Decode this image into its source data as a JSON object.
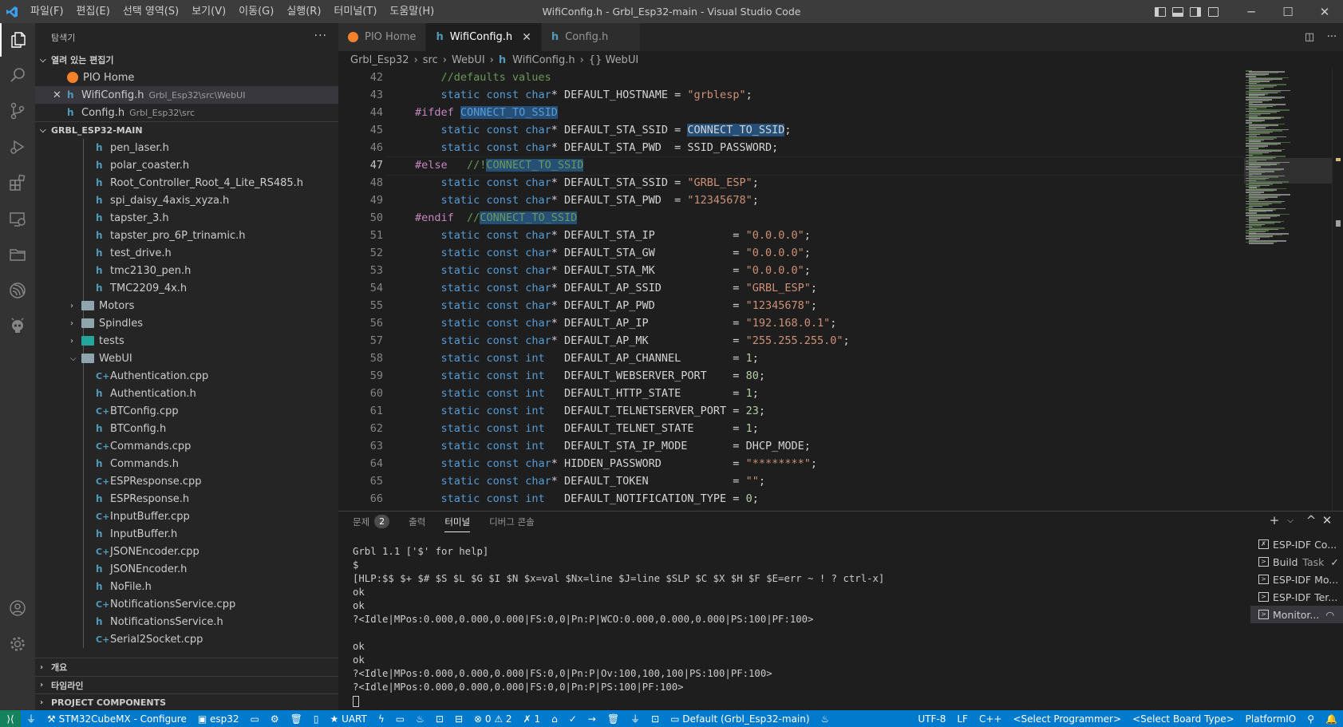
{
  "titlebar": {
    "menus": [
      "파일(F)",
      "편집(E)",
      "선택 영역(S)",
      "보기(V)",
      "이동(G)",
      "실행(R)",
      "터미널(T)",
      "도움말(H)"
    ],
    "title": "WifiConfig.h - Grbl_Esp32-main - Visual Studio Code"
  },
  "sidebar": {
    "header": "탐색기",
    "open_editors_title": "열려 있는 편집기",
    "open_editors": [
      {
        "name": "PIO Home",
        "desc": ""
      },
      {
        "name": "WifiConfig.h",
        "desc": "Grbl_Esp32\\src\\WebUI"
      },
      {
        "name": "Config.h",
        "desc": "Grbl_Esp32\\src"
      }
    ],
    "project_title": "GRBL_ESP32-MAIN",
    "files_top": [
      "pen_laser.h",
      "polar_coaster.h",
      "Root_Controller_Root_4_Lite_RS485.h",
      "spi_daisy_4axis_xyza.h",
      "tapster_3.h",
      "tapster_pro_6P_trinamic.h",
      "test_drive.h",
      "tmc2130_pen.h",
      "TMC2209_4x.h"
    ],
    "folders": [
      "Motors",
      "Spindles",
      "tests",
      "WebUI"
    ],
    "webui_files": [
      {
        "name": "Authentication.cpp",
        "type": "cpp"
      },
      {
        "name": "Authentication.h",
        "type": "h"
      },
      {
        "name": "BTConfig.cpp",
        "type": "cpp"
      },
      {
        "name": "BTConfig.h",
        "type": "h"
      },
      {
        "name": "Commands.cpp",
        "type": "cpp"
      },
      {
        "name": "Commands.h",
        "type": "h"
      },
      {
        "name": "ESPResponse.cpp",
        "type": "cpp"
      },
      {
        "name": "ESPResponse.h",
        "type": "h"
      },
      {
        "name": "InputBuffer.cpp",
        "type": "cpp"
      },
      {
        "name": "InputBuffer.h",
        "type": "h"
      },
      {
        "name": "JSONEncoder.cpp",
        "type": "cpp"
      },
      {
        "name": "JSONEncoder.h",
        "type": "h"
      },
      {
        "name": "NoFile.h",
        "type": "h"
      },
      {
        "name": "NotificationsService.cpp",
        "type": "cpp"
      },
      {
        "name": "NotificationsService.h",
        "type": "h"
      },
      {
        "name": "Serial2Socket.cpp",
        "type": "cpp"
      }
    ],
    "bottom_sections": [
      "개요",
      "타임라인",
      "PROJECT COMPONENTS"
    ]
  },
  "tabs": [
    {
      "label": "PIO Home",
      "icon": "pio"
    },
    {
      "label": "WifiConfig.h",
      "icon": "h",
      "active": true
    },
    {
      "label": "Config.h",
      "icon": "h"
    }
  ],
  "breadcrumb": [
    "Grbl_Esp32",
    "src",
    "WebUI",
    "WifiConfig.h",
    "{} WebUI"
  ],
  "editor": {
    "active_line": 47,
    "lines": [
      {
        "n": 42,
        "html": "    <span class='cmt'>//defaults values</span>"
      },
      {
        "n": 43,
        "html": "    <span class='kw'>static</span> <span class='kw'>const</span> <span class='kw'>char</span>* DEFAULT_HOSTNAME = <span class='str'>\"grblesp\"</span>;"
      },
      {
        "n": 44,
        "html": "<span class='pp'>#ifdef</span> <span class='hl mac'>CONNECT_TO_SSID</span>"
      },
      {
        "n": 45,
        "html": "    <span class='kw'>static</span> <span class='kw'>const</span> <span class='kw'>char</span>* DEFAULT_STA_SSID = <span class='hl'>CONNECT_TO_SSID</span>;"
      },
      {
        "n": 46,
        "html": "    <span class='kw'>static</span> <span class='kw'>const</span> <span class='kw'>char</span>* DEFAULT_STA_PWD  = SSID_PASSWORD;"
      },
      {
        "n": 47,
        "html": "<span class='pp'>#else</span>   <span class='cmt'>//!<span class='hl'>CONNECT_TO_SSID</span></span>"
      },
      {
        "n": 48,
        "html": "    <span class='kw'>static</span> <span class='kw'>const</span> <span class='kw'>char</span>* DEFAULT_STA_SSID = <span class='str'>\"GRBL_ESP\"</span>;"
      },
      {
        "n": 49,
        "html": "    <span class='kw'>static</span> <span class='kw'>const</span> <span class='kw'>char</span>* DEFAULT_STA_PWD  = <span class='str'>\"12345678\"</span>;"
      },
      {
        "n": 50,
        "html": "<span class='pp'>#endif</span>  <span class='cmt'>//<span class='hl'>CONNECT_TO_SSID</span></span>"
      },
      {
        "n": 51,
        "html": "    <span class='kw'>static</span> <span class='kw'>const</span> <span class='kw'>char</span>* DEFAULT_STA_IP            = <span class='str'>\"0.0.0.0\"</span>;"
      },
      {
        "n": 52,
        "html": "    <span class='kw'>static</span> <span class='kw'>const</span> <span class='kw'>char</span>* DEFAULT_STA_GW            = <span class='str'>\"0.0.0.0\"</span>;"
      },
      {
        "n": 53,
        "html": "    <span class='kw'>static</span> <span class='kw'>const</span> <span class='kw'>char</span>* DEFAULT_STA_MK            = <span class='str'>\"0.0.0.0\"</span>;"
      },
      {
        "n": 54,
        "html": "    <span class='kw'>static</span> <span class='kw'>const</span> <span class='kw'>char</span>* DEFAULT_AP_SSID           = <span class='str'>\"GRBL_ESP\"</span>;"
      },
      {
        "n": 55,
        "html": "    <span class='kw'>static</span> <span class='kw'>const</span> <span class='kw'>char</span>* DEFAULT_AP_PWD            = <span class='str'>\"12345678\"</span>;"
      },
      {
        "n": 56,
        "html": "    <span class='kw'>static</span> <span class='kw'>const</span> <span class='kw'>char</span>* DEFAULT_AP_IP             = <span class='str'>\"192.168.0.1\"</span>;"
      },
      {
        "n": 57,
        "html": "    <span class='kw'>static</span> <span class='kw'>const</span> <span class='kw'>char</span>* DEFAULT_AP_MK             = <span class='str'>\"255.255.255.0\"</span>;"
      },
      {
        "n": 58,
        "html": "    <span class='kw'>static</span> <span class='kw'>const</span> <span class='kw'>int</span>   DEFAULT_AP_CHANNEL        = <span class='num'>1</span>;"
      },
      {
        "n": 59,
        "html": "    <span class='kw'>static</span> <span class='kw'>const</span> <span class='kw'>int</span>   DEFAULT_WEBSERVER_PORT    = <span class='num'>80</span>;"
      },
      {
        "n": 60,
        "html": "    <span class='kw'>static</span> <span class='kw'>const</span> <span class='kw'>int</span>   DEFAULT_HTTP_STATE        = <span class='num'>1</span>;"
      },
      {
        "n": 61,
        "html": "    <span class='kw'>static</span> <span class='kw'>const</span> <span class='kw'>int</span>   DEFAULT_TELNETSERVER_PORT = <span class='num'>23</span>;"
      },
      {
        "n": 62,
        "html": "    <span class='kw'>static</span> <span class='kw'>const</span> <span class='kw'>int</span>   DEFAULT_TELNET_STATE      = <span class='num'>1</span>;"
      },
      {
        "n": 63,
        "html": "    <span class='kw'>static</span> <span class='kw'>const</span> <span class='kw'>int</span>   DEFAULT_STA_IP_MODE       = DHCP_MODE;"
      },
      {
        "n": 64,
        "html": "    <span class='kw'>static</span> <span class='kw'>const</span> <span class='kw'>char</span>* HIDDEN_PASSWORD           = <span class='str'>\"********\"</span>;"
      },
      {
        "n": 65,
        "html": "    <span class='kw'>static</span> <span class='kw'>const</span> <span class='kw'>char</span>* DEFAULT_TOKEN             = <span class='str'>\"\"</span>;"
      },
      {
        "n": 66,
        "html": "    <span class='kw'>static</span> <span class='kw'>const</span> <span class='kw'>int</span>   DEFAULT_NOTIFICATION_TYPE = <span class='num'>0</span>;"
      }
    ]
  },
  "panel": {
    "tabs": [
      {
        "label": "문제",
        "badge": "2"
      },
      {
        "label": "출력"
      },
      {
        "label": "터미널",
        "active": true
      },
      {
        "label": "디버그 콘솔"
      }
    ],
    "terminal_lines": [
      "Grbl 1.1 ['$' for help]",
      "$",
      "[HLP:$$ $+ $# $S $L $G $I $N $x=val $Nx=line $J=line $SLP $C $X $H $F $E=err ~ ! ? ctrl-x]",
      "ok",
      "ok",
      "?<Idle|MPos:0.000,0.000,0.000|FS:0,0|Pn:P|WCO:0.000,0.000,0.000|PS:100|PF:100>",
      "",
      "ok",
      "ok",
      "?<Idle|MPos:0.000,0.000,0.000|FS:0,0|Pn:P|Ov:100,100,100|PS:100|PF:100>",
      "?<Idle|MPos:0.000,0.000,0.000|FS:0,0|Pn:P|PS:100|PF:100>"
    ],
    "terminal_list": [
      {
        "label": "ESP-IDF Co...",
        "icon": "tools"
      },
      {
        "label": "Build",
        "task": "Task",
        "icon": "term",
        "check": "✓"
      },
      {
        "label": "ESP-IDF Mo...",
        "icon": "term"
      },
      {
        "label": "ESP-IDF Ter...",
        "icon": "term"
      },
      {
        "label": "Monitor...",
        "icon": "term",
        "active": true
      }
    ]
  },
  "statusbar": {
    "left": [
      "STM32CubeMX - Configure",
      "esp32",
      "UART",
      "0",
      "2",
      "1",
      "Default (Grbl_Esp32-main)"
    ],
    "right": [
      "UTF-8",
      "LF",
      "C++",
      "<Select Programmer>",
      "<Select Board Type>",
      "PlatformIO"
    ]
  },
  "colors": {
    "accent": "#007acc",
    "remote": "#16825d",
    "editor_bg": "#1e1e1e",
    "sidebar_bg": "#252526"
  }
}
